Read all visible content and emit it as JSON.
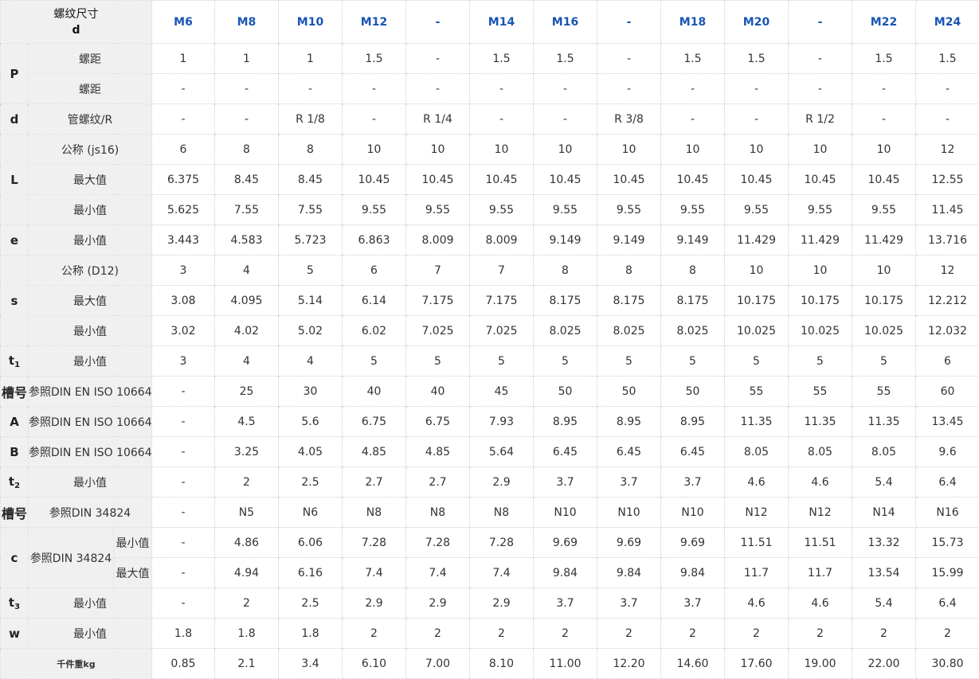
{
  "header": {
    "size_line1": "螺纹尺寸",
    "size_line2": "d",
    "columns": [
      "M6",
      "M8",
      "M10",
      "M12",
      "-",
      "M14",
      "M16",
      "-",
      "M18",
      "M20",
      "-",
      "M22",
      "M24"
    ]
  },
  "groups": [
    {
      "symbol": "P",
      "sub": "",
      "rows": [
        {
          "label": "螺距",
          "values": [
            "1",
            "1",
            "1",
            "1.5",
            "-",
            "1.5",
            "1.5",
            "-",
            "1.5",
            "1.5",
            "-",
            "1.5",
            "1.5"
          ]
        },
        {
          "label": "螺距",
          "values": [
            "-",
            "-",
            "-",
            "-",
            "-",
            "-",
            "-",
            "-",
            "-",
            "-",
            "-",
            "-",
            "-"
          ]
        }
      ]
    },
    {
      "symbol": "d",
      "sub": "",
      "rows": [
        {
          "label": "管螺纹/R",
          "values": [
            "-",
            "-",
            "R 1/8",
            "-",
            "R 1/4",
            "-",
            "-",
            "R 3/8",
            "-",
            "-",
            "R 1/2",
            "-",
            "-"
          ]
        }
      ]
    },
    {
      "symbol": "L",
      "sub": "",
      "rows": [
        {
          "label": "公称 (js16)",
          "values": [
            "6",
            "8",
            "8",
            "10",
            "10",
            "10",
            "10",
            "10",
            "10",
            "10",
            "10",
            "10",
            "12"
          ]
        },
        {
          "label": "最大值",
          "values": [
            "6.375",
            "8.45",
            "8.45",
            "10.45",
            "10.45",
            "10.45",
            "10.45",
            "10.45",
            "10.45",
            "10.45",
            "10.45",
            "10.45",
            "12.55"
          ]
        },
        {
          "label": "最小值",
          "values": [
            "5.625",
            "7.55",
            "7.55",
            "9.55",
            "9.55",
            "9.55",
            "9.55",
            "9.55",
            "9.55",
            "9.55",
            "9.55",
            "9.55",
            "11.45"
          ]
        }
      ]
    },
    {
      "symbol": "e",
      "sub": "",
      "rows": [
        {
          "label": "最小值",
          "values": [
            "3.443",
            "4.583",
            "5.723",
            "6.863",
            "8.009",
            "8.009",
            "9.149",
            "9.149",
            "9.149",
            "11.429",
            "11.429",
            "11.429",
            "13.716"
          ]
        }
      ]
    },
    {
      "symbol": "s",
      "sub": "",
      "rows": [
        {
          "label": "公称 (D12)",
          "values": [
            "3",
            "4",
            "5",
            "6",
            "7",
            "7",
            "8",
            "8",
            "8",
            "10",
            "10",
            "10",
            "12"
          ]
        },
        {
          "label": "最大值",
          "values": [
            "3.08",
            "4.095",
            "5.14",
            "6.14",
            "7.175",
            "7.175",
            "8.175",
            "8.175",
            "8.175",
            "10.175",
            "10.175",
            "10.175",
            "12.212"
          ]
        },
        {
          "label": "最小值",
          "values": [
            "3.02",
            "4.02",
            "5.02",
            "6.02",
            "7.025",
            "7.025",
            "8.025",
            "8.025",
            "8.025",
            "10.025",
            "10.025",
            "10.025",
            "12.032"
          ]
        }
      ]
    },
    {
      "symbol": "t",
      "sub": "1",
      "rows": [
        {
          "label": "最小值",
          "values": [
            "3",
            "4",
            "4",
            "5",
            "5",
            "5",
            "5",
            "5",
            "5",
            "5",
            "5",
            "5",
            "6"
          ]
        }
      ]
    },
    {
      "symbol": "槽号",
      "sub": "",
      "rows": [
        {
          "label": "参照DIN EN ISO 10664",
          "values": [
            "-",
            "25",
            "30",
            "40",
            "40",
            "45",
            "50",
            "50",
            "50",
            "55",
            "55",
            "55",
            "60"
          ]
        }
      ]
    },
    {
      "symbol": "A",
      "sub": "",
      "rows": [
        {
          "label": "参照DIN EN ISO 10664",
          "values": [
            "-",
            "4.5",
            "5.6",
            "6.75",
            "6.75",
            "7.93",
            "8.95",
            "8.95",
            "8.95",
            "11.35",
            "11.35",
            "11.35",
            "13.45"
          ]
        }
      ]
    },
    {
      "symbol": "B",
      "sub": "",
      "rows": [
        {
          "label": "参照DIN EN ISO 10664",
          "values": [
            "-",
            "3.25",
            "4.05",
            "4.85",
            "4.85",
            "5.64",
            "6.45",
            "6.45",
            "6.45",
            "8.05",
            "8.05",
            "8.05",
            "9.6"
          ]
        }
      ]
    },
    {
      "symbol": "t",
      "sub": "2",
      "rows": [
        {
          "label": "最小值",
          "values": [
            "-",
            "2",
            "2.5",
            "2.7",
            "2.7",
            "2.9",
            "3.7",
            "3.7",
            "3.7",
            "4.6",
            "4.6",
            "5.4",
            "6.4"
          ]
        }
      ]
    },
    {
      "symbol": "槽号",
      "sub": "",
      "rows": [
        {
          "label": "参照DIN 34824",
          "values": [
            "-",
            "N5",
            "N6",
            "N8",
            "N8",
            "N8",
            "N10",
            "N10",
            "N10",
            "N12",
            "N12",
            "N14",
            "N16"
          ]
        }
      ]
    },
    {
      "symbol": "c",
      "sub": "",
      "mid_label": "参照DIN 34824",
      "rows": [
        {
          "label": "最小值",
          "values": [
            "-",
            "4.86",
            "6.06",
            "7.28",
            "7.28",
            "7.28",
            "9.69",
            "9.69",
            "9.69",
            "11.51",
            "11.51",
            "13.32",
            "15.73"
          ]
        },
        {
          "label": "最大值",
          "values": [
            "-",
            "4.94",
            "6.16",
            "7.4",
            "7.4",
            "7.4",
            "9.84",
            "9.84",
            "9.84",
            "11.7",
            "11.7",
            "13.54",
            "15.99"
          ]
        }
      ]
    },
    {
      "symbol": "t",
      "sub": "3",
      "rows": [
        {
          "label": "最小值",
          "values": [
            "-",
            "2",
            "2.5",
            "2.9",
            "2.9",
            "2.9",
            "3.7",
            "3.7",
            "3.7",
            "4.6",
            "4.6",
            "5.4",
            "6.4"
          ]
        }
      ]
    },
    {
      "symbol": "w",
      "sub": "",
      "rows": [
        {
          "label": "最小值",
          "values": [
            "1.8",
            "1.8",
            "1.8",
            "2",
            "2",
            "2",
            "2",
            "2",
            "2",
            "2",
            "2",
            "2",
            "2"
          ]
        }
      ]
    }
  ],
  "weight_row": {
    "label": "千件重kg",
    "values": [
      "0.85",
      "2.1",
      "3.4",
      "6.10",
      "7.00",
      "8.10",
      "11.00",
      "12.20",
      "14.60",
      "17.60",
      "19.00",
      "22.00",
      "30.80"
    ]
  }
}
